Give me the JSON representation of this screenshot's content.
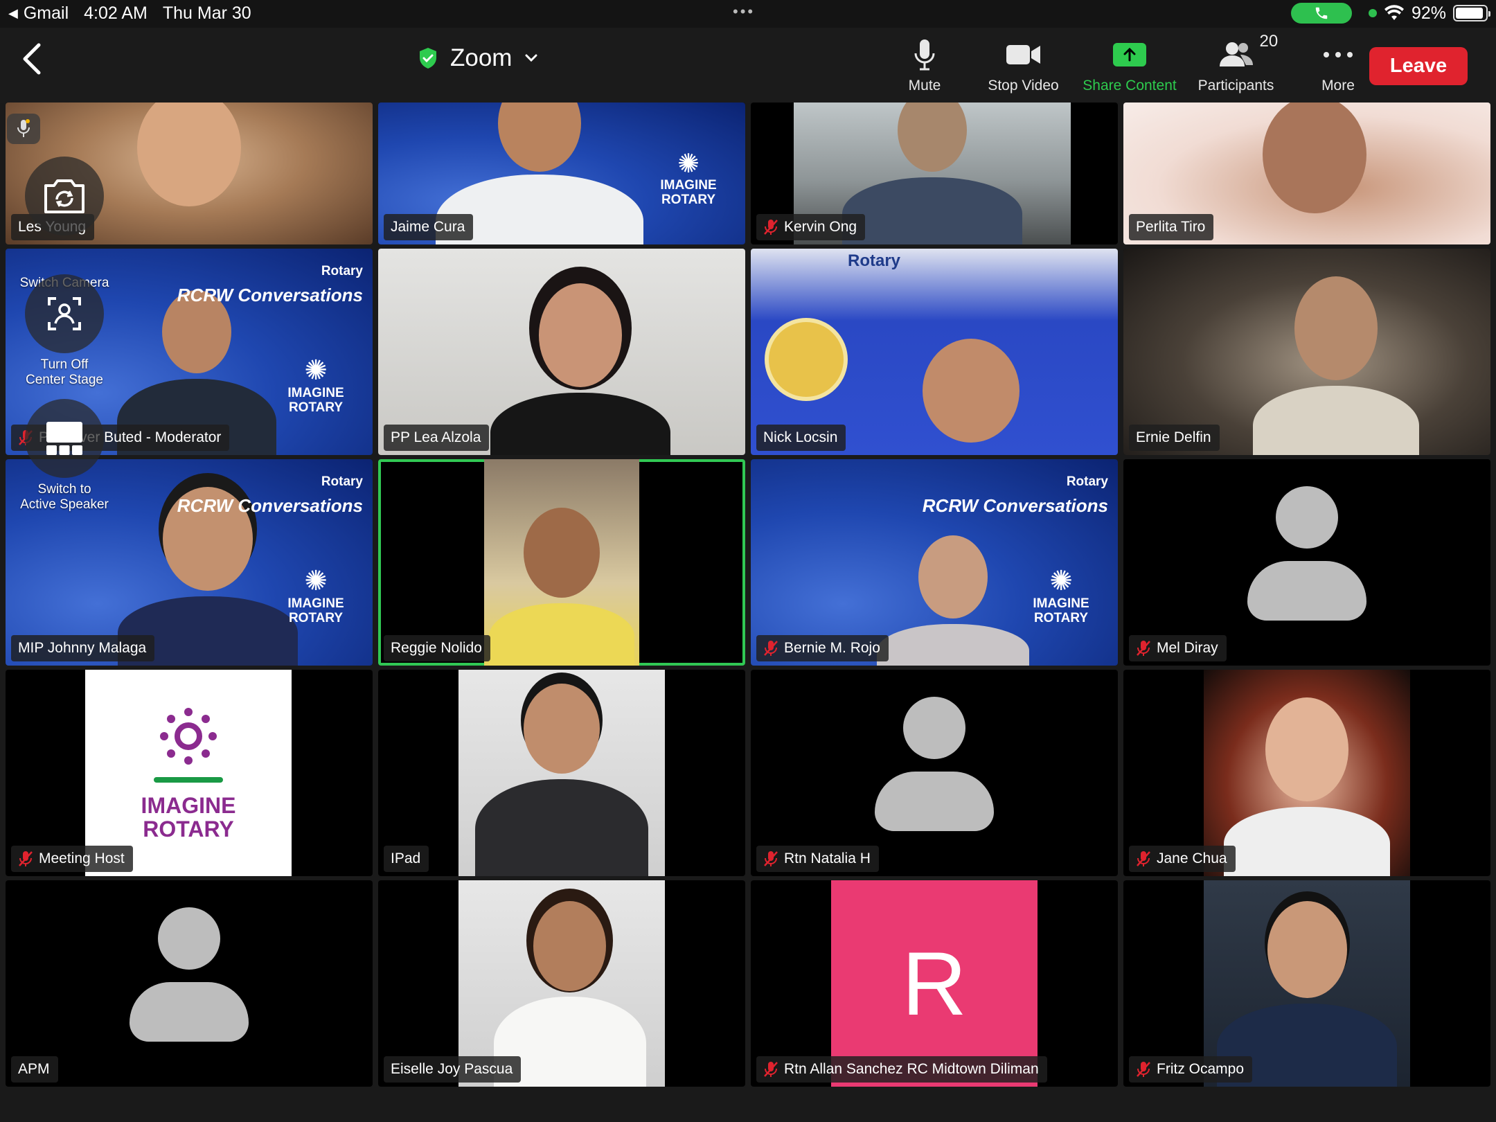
{
  "status_bar": {
    "back_app": "Gmail",
    "time": "4:02 AM",
    "date": "Thu Mar 30",
    "battery": "92%",
    "battery_level": 0.92
  },
  "toolbar": {
    "title": "Zoom",
    "mute_label": "Mute",
    "stop_video_label": "Stop Video",
    "share_label": "Share Content",
    "participants_label": "Participants",
    "participants_count": "20",
    "more_label": "More",
    "leave_label": "Leave"
  },
  "overlay": {
    "switch_camera": "Switch Camera",
    "center_stage_1": "Turn Off",
    "center_stage_2": "Center Stage",
    "active_speaker_1": "Switch to",
    "active_speaker_2": "Active Speaker"
  },
  "participants": [
    {
      "name": "Les Young"
    },
    {
      "name": "Jaime Cura"
    },
    {
      "name": "Kervin Ong"
    },
    {
      "name": "Perlita Tiro"
    },
    {
      "name": "PP Oliver Buted - Moderator"
    },
    {
      "name": "PP Lea Alzola"
    },
    {
      "name": "Nick Locsin"
    },
    {
      "name": "Ernie Delfin"
    },
    {
      "name": "MIP Johnny Malaga"
    },
    {
      "name": "Reggie Nolido"
    },
    {
      "name": "Bernie M. Rojo"
    },
    {
      "name": "Mel Diray"
    },
    {
      "name": "Meeting Host"
    },
    {
      "name": "IPad"
    },
    {
      "name": "Rtn Natalia H"
    },
    {
      "name": "Jane Chua"
    },
    {
      "name": "APM"
    },
    {
      "name": "Eiselle Joy Pascua"
    },
    {
      "name": "Rtn Allan Sanchez RC Midtown Diliman"
    },
    {
      "name": "Fritz Ocampo"
    }
  ],
  "branding": {
    "rotary": "Rotary",
    "rcrw": "RCRW Conversations",
    "imagine_1": "IMAGINE",
    "imagine_2": "ROTARY",
    "initial_letter": "R"
  },
  "colors": {
    "accent_green": "#2ecb4e",
    "leave_red": "#e0232e",
    "mute_red": "#e0232e",
    "imagine_purple": "#8b2b8f"
  }
}
